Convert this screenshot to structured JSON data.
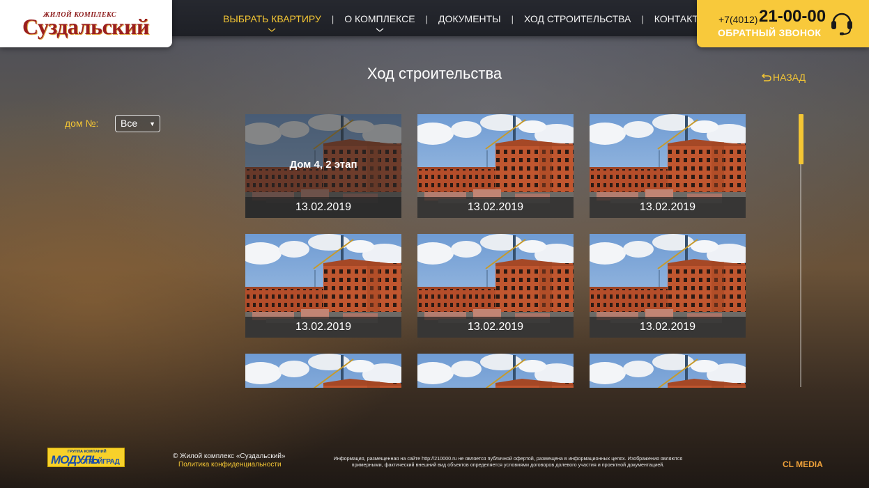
{
  "logo": {
    "subtitle": "ЖИЛОЙ КОМПЛЕКС",
    "name": "Суздальский"
  },
  "nav": {
    "items": [
      {
        "label": "ВЫБРАТЬ КВАРТИРУ",
        "active": true
      },
      {
        "label": "О КОМПЛЕКСЕ",
        "active": false
      },
      {
        "label": "ДОКУМЕНТЫ",
        "active": false
      },
      {
        "label": "ХОД СТРОИТЕЛЬСТВА",
        "active": false
      },
      {
        "label": "КОНТАКТЫ",
        "active": false
      }
    ],
    "separator": "|"
  },
  "contact": {
    "phone_code": "+7(4012)",
    "phone_number": "21-00-00",
    "callback_label": "ОБРАТНЫЙ ЗВОНОК"
  },
  "page": {
    "title": "Ход строительства",
    "back_label": "НАЗАД"
  },
  "filter": {
    "label": "дом №:",
    "selected": "Все",
    "arrow": "▼"
  },
  "gallery": {
    "cards": [
      {
        "date": "13.02.2019",
        "hover_title": "Дом 4, 2 этап"
      },
      {
        "date": "13.02.2019"
      },
      {
        "date": "13.02.2019"
      },
      {
        "date": "13.02.2019"
      },
      {
        "date": "13.02.2019"
      },
      {
        "date": "13.02.2019"
      },
      {
        "date": ""
      },
      {
        "date": ""
      },
      {
        "date": ""
      }
    ]
  },
  "footer": {
    "partner_small": "ГРУППА КОМПАНИЙ",
    "partner_big": "МОДУЛЬ",
    "partner_right": "СТРОЙГРАД",
    "copyright": "© Жилой комплекс «Суздальский»",
    "privacy": "Политика конфиденциальности",
    "disclaimer": "Информация, размещенная на сайте http://210000.ru не является публичной офертой, размещена в информационных целях. Изображения являются примерными, фактический внешний вид объектов определяется условиями договоров долевого участия и проектной документацией.",
    "developer": "CL MEDIA"
  },
  "colors": {
    "accent": "#f4c634",
    "phone_bg": "#f8c93b",
    "brand_red": "#9a1f1f",
    "header_bg": "#1e2026"
  }
}
